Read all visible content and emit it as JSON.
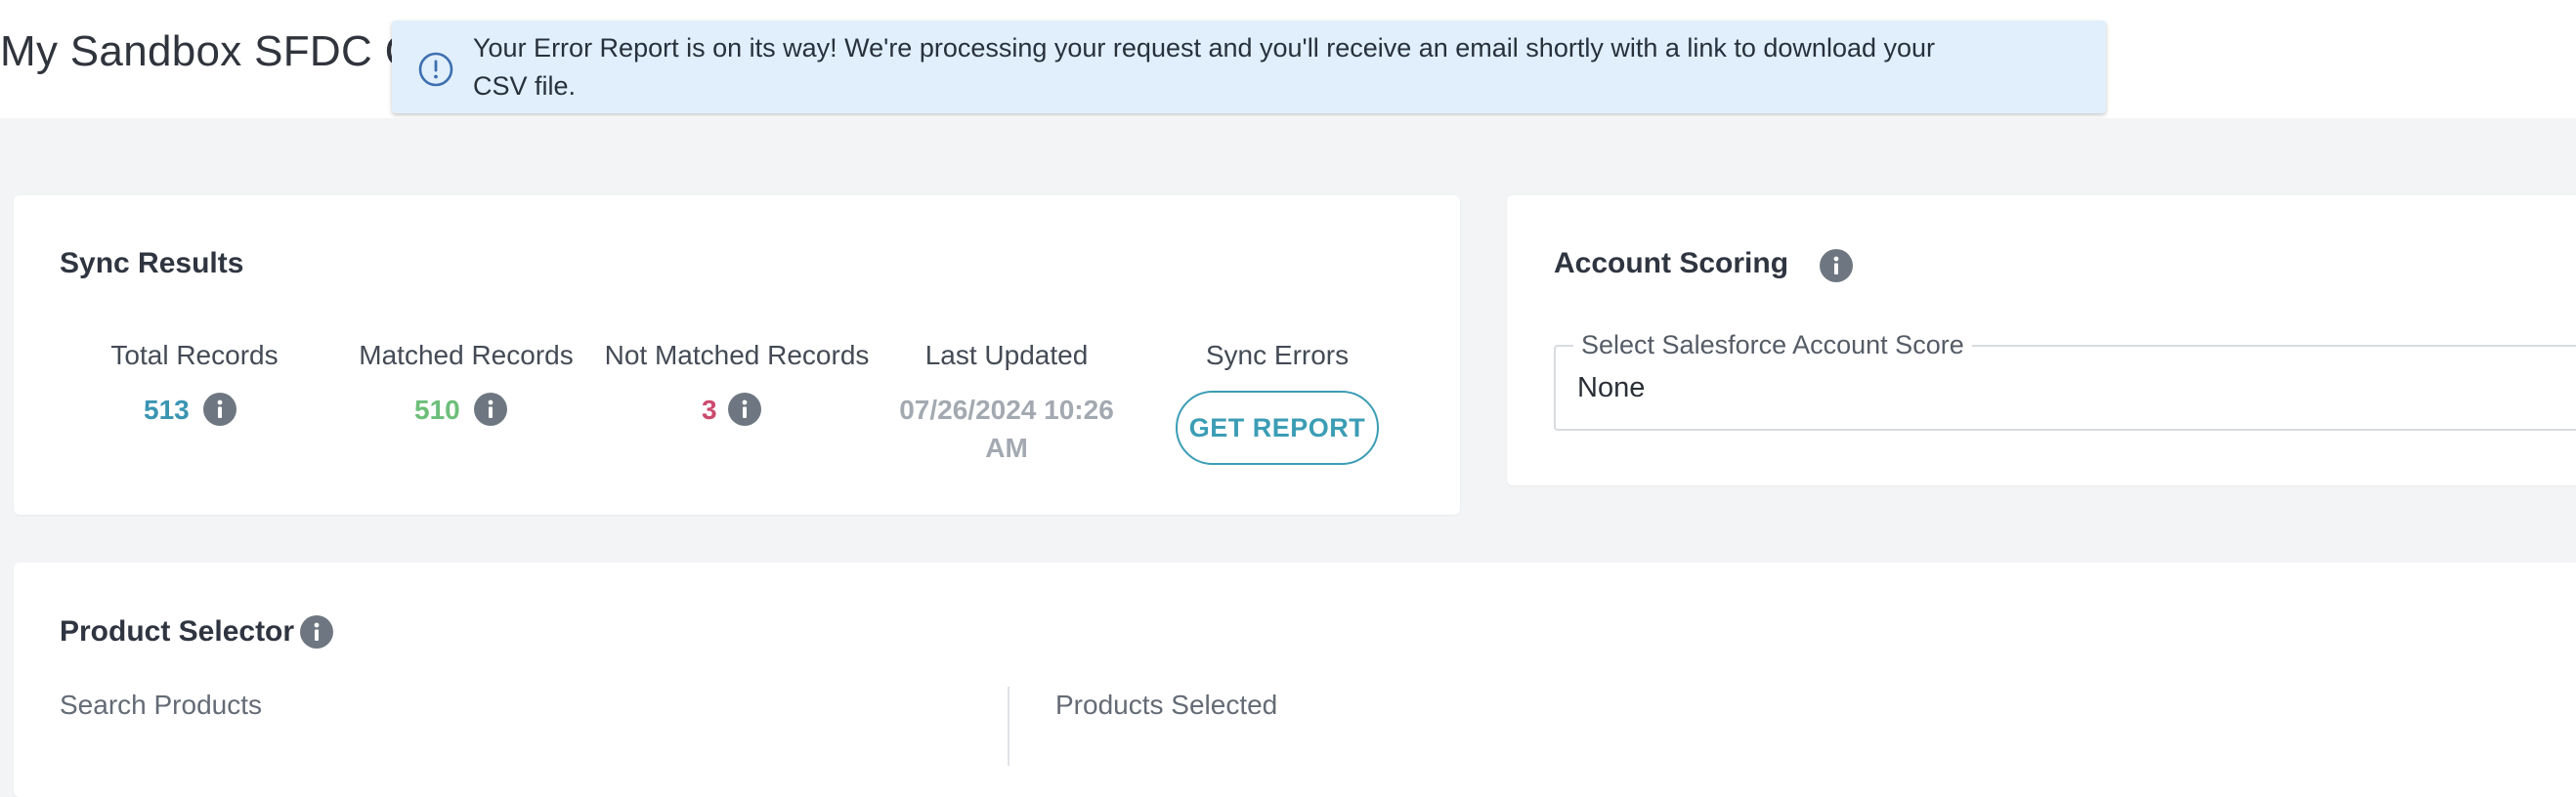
{
  "page": {
    "title": "My Sandbox SFDC C"
  },
  "toast": {
    "icon": "alert-circle-icon",
    "message": "Your Error Report is on its way! We're processing your request and you'll receive an email shortly with a link to download your CSV file."
  },
  "sync_results": {
    "title": "Sync Results",
    "stats": [
      {
        "label": "Total Records",
        "value": "513",
        "color": "#3a95b2"
      },
      {
        "label": "Matched Records",
        "value": "510",
        "color": "#6cbf7a"
      },
      {
        "label": "Not Matched Records",
        "value": "3",
        "color": "#cc4a6e"
      }
    ],
    "last_updated": {
      "label": "Last Updated",
      "value": "07/26/2024 10:26 AM"
    },
    "sync_errors": {
      "label": "Sync Errors",
      "button_label": "GET REPORT"
    }
  },
  "account_scoring": {
    "title": "Account Scoring",
    "select_label": "Select Salesforce Account Score",
    "select_value": "None"
  },
  "product_selector": {
    "title": "Product Selector",
    "search_label": "Search Products",
    "selected_label": "Products Selected"
  },
  "colors": {
    "accent": "#3b9db5",
    "toast_bg": "#e0effb",
    "info_icon": "#6e7781",
    "page_bg": "#f3f4f6"
  }
}
